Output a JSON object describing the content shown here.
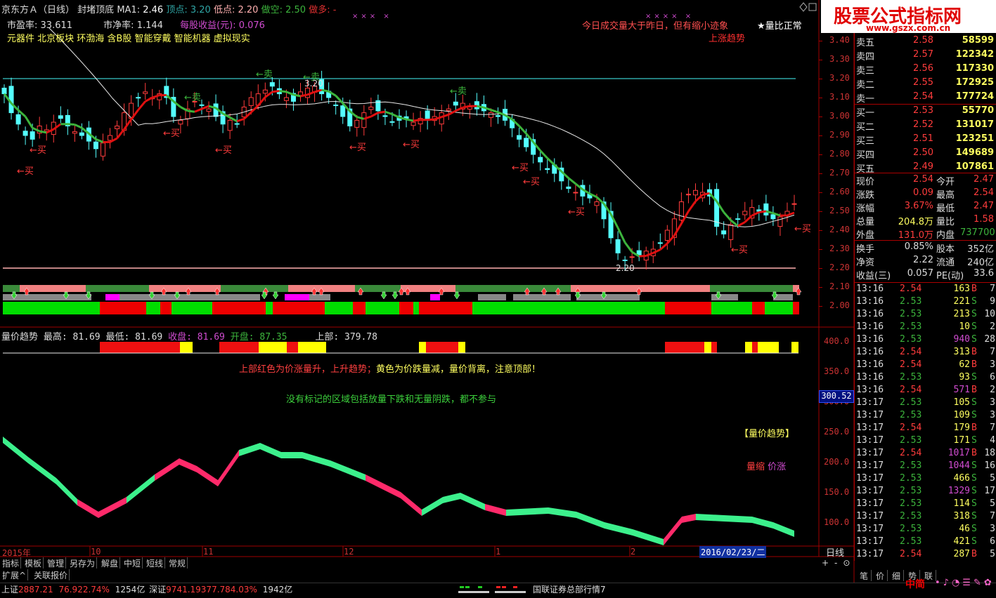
{
  "header": {
    "title": "京东方Ａ（日线）",
    "indicator": "封堵顶底",
    "ma1_label": "MA1:",
    "ma1_value": "2.46",
    "top_label": "顶点:",
    "top_value": "3.20",
    "low_label": "低点:",
    "low_value": "2.20",
    "short_label": "做空:",
    "short_value": "2.50",
    "long_label": "做多:",
    "long_value": "-",
    "pe_label": "市盈率:",
    "pe_value": "33.611",
    "pb_label": "市净率:",
    "pb_value": "1.144",
    "eps_label": "每股收益(元):",
    "eps_value": "0.076",
    "sectors": "元器件 北京板块 环渤海 含B股 智能穿戴 智能机器 虚拟现实",
    "notice": "今日成交量大于昨日，但有缩小迹象",
    "volume_ratio": "★量比正常",
    "trend": "上涨趋势",
    "watermark_title": "股票公式指标网",
    "watermark_url": "www.gszx.com.cn"
  },
  "price_axis": [
    "3.40",
    "3.30",
    "3.20",
    "3.10",
    "3.00",
    "2.90",
    "2.80",
    "2.70",
    "2.60",
    "2.50",
    "2.40",
    "2.30",
    "2.20",
    "2.10",
    "2.00"
  ],
  "chart_annotations": {
    "buy": "←买",
    "sell": "←卖",
    "top_price": "3.20",
    "bottom_price": "2.20"
  },
  "lower_panel": {
    "title": "量价趋势",
    "high_label": "最高:",
    "high_value": "81.69",
    "low_label": "最低:",
    "low_value": "81.69",
    "close_label": "收盘:",
    "close_value": "81.69",
    "open_label": "开盘:",
    "open_value": "87.35",
    "upper_label": "上部:",
    "upper_value": "379.78",
    "note1": "上部红色为价涨量升，上升趋势；",
    "note1b": "黄色为价跌量减，量价背离，注意顶部！",
    "note2": "没有标记的区域包括放量下跌和无量阴跌，都不参与",
    "legend_title": "【量价趋势】",
    "legend_a": "量缩",
    "legend_b": "价涨",
    "axis": [
      "400.0",
      "350.0",
      "300.0",
      "250.0",
      "200.0",
      "150.0",
      "100.0"
    ],
    "current": "300.52"
  },
  "x_axis": {
    "year": "2015年",
    "m10": "10",
    "m11": "11",
    "m12": "12",
    "m1": "1",
    "m2": "2",
    "cursor_date": "2016/02/23/二",
    "period": "日线"
  },
  "bottom_tabs": [
    "指标",
    "模板",
    "管理",
    "另存为",
    "解盘",
    "中短",
    "短线",
    "常规"
  ],
  "bottom_tabs2": [
    "扩展^",
    "关联报价"
  ],
  "quotes": {
    "asks": [
      {
        "label": "卖五",
        "price": "2.58",
        "vol": "58599"
      },
      {
        "label": "卖四",
        "price": "2.57",
        "vol": "122342"
      },
      {
        "label": "卖三",
        "price": "2.56",
        "vol": "117330"
      },
      {
        "label": "卖二",
        "price": "2.55",
        "vol": "172925"
      },
      {
        "label": "卖一",
        "price": "2.54",
        "vol": "177724"
      }
    ],
    "bids": [
      {
        "label": "买一",
        "price": "2.53",
        "vol": "55770"
      },
      {
        "label": "买二",
        "price": "2.52",
        "vol": "131017"
      },
      {
        "label": "买三",
        "price": "2.51",
        "vol": "123251"
      },
      {
        "label": "买四",
        "price": "2.50",
        "vol": "149689"
      },
      {
        "label": "买五",
        "price": "2.49",
        "vol": "107861"
      }
    ],
    "stats": [
      {
        "l1": "现价",
        "v1": "2.54",
        "l2": "今开",
        "v2": "2.47"
      },
      {
        "l1": "涨跌",
        "v1": "0.09",
        "l2": "最高",
        "v2": "2.54"
      },
      {
        "l1": "涨幅",
        "v1": "3.67%",
        "l2": "最低",
        "v2": "2.47"
      },
      {
        "l1": "总量",
        "v1": "204.8万",
        "l2": "量比",
        "v2": "1.58"
      },
      {
        "l1": "外盘",
        "v1": "131.0万",
        "l2": "内盘",
        "v2": "737700"
      }
    ],
    "stats2": [
      {
        "l1": "换手",
        "v1": "0.85%",
        "l2": "股本",
        "v2": "352亿"
      },
      {
        "l1": "净资",
        "v1": "2.22",
        "l2": "流通",
        "v2": "240亿"
      },
      {
        "l1": "收益(三)",
        "v1": "0.057",
        "l2": "PE(动)",
        "v2": "33.6"
      }
    ]
  },
  "ticks": [
    {
      "t": "13:16",
      "p": "2.54",
      "v": "163",
      "s": "B",
      "n": "7"
    },
    {
      "t": "13:16",
      "p": "2.53",
      "v": "221",
      "s": "S",
      "n": "9"
    },
    {
      "t": "13:16",
      "p": "2.53",
      "v": "213",
      "s": "S",
      "n": "10"
    },
    {
      "t": "13:16",
      "p": "2.53",
      "v": "10",
      "s": "S",
      "n": "2"
    },
    {
      "t": "13:16",
      "p": "2.53",
      "v": "940",
      "s": "S",
      "n": "28"
    },
    {
      "t": "13:16",
      "p": "2.54",
      "v": "313",
      "s": "B",
      "n": "7"
    },
    {
      "t": "13:16",
      "p": "2.54",
      "v": "62",
      "s": "B",
      "n": "3"
    },
    {
      "t": "13:16",
      "p": "2.53",
      "v": "93",
      "s": "S",
      "n": "6"
    },
    {
      "t": "13:16",
      "p": "2.54",
      "v": "571",
      "s": "B",
      "n": "2"
    },
    {
      "t": "13:17",
      "p": "2.53",
      "v": "105",
      "s": "S",
      "n": "3"
    },
    {
      "t": "13:17",
      "p": "2.53",
      "v": "109",
      "s": "S",
      "n": "3"
    },
    {
      "t": "13:17",
      "p": "2.54",
      "v": "179",
      "s": "B",
      "n": "7"
    },
    {
      "t": "13:17",
      "p": "2.53",
      "v": "171",
      "s": "S",
      "n": "4"
    },
    {
      "t": "13:17",
      "p": "2.54",
      "v": "1017",
      "s": "B",
      "n": "18"
    },
    {
      "t": "13:17",
      "p": "2.53",
      "v": "1044",
      "s": "S",
      "n": "16"
    },
    {
      "t": "13:17",
      "p": "2.53",
      "v": "466",
      "s": "S",
      "n": "5"
    },
    {
      "t": "13:17",
      "p": "2.53",
      "v": "1329",
      "s": "S",
      "n": "17"
    },
    {
      "t": "13:17",
      "p": "2.53",
      "v": "114",
      "s": "S",
      "n": "5"
    },
    {
      "t": "13:17",
      "p": "2.53",
      "v": "318",
      "s": "S",
      "n": "7"
    },
    {
      "t": "13:17",
      "p": "2.53",
      "v": "46",
      "s": "S",
      "n": "3"
    },
    {
      "t": "13:17",
      "p": "2.53",
      "v": "421",
      "s": "S",
      "n": "6"
    },
    {
      "t": "13:17",
      "p": "2.54",
      "v": "287",
      "s": "B",
      "n": "5"
    }
  ],
  "side_tabs": [
    "笔",
    "价",
    "细",
    "势",
    "联"
  ],
  "status_bar": {
    "sh_label": "上证",
    "sh_value": "2887.21",
    "sh_change": "76.92",
    "sh_pct": "2.74%",
    "sh_amount": "1254亿",
    "sz_label": "深证",
    "sz_value": "9741.19",
    "sz_change": "377.78",
    "sz_pct": "4.03%",
    "sz_amount": "1942亿",
    "broker": "国联证券总部行情7",
    "logo": "中简"
  },
  "colors": {
    "up": "#ff3c3c",
    "down": "#54ffff",
    "ma_green": "#3cb43c",
    "ma_red": "#e01010",
    "ma_white": "#e8e8e8",
    "border": "#a00000"
  }
}
